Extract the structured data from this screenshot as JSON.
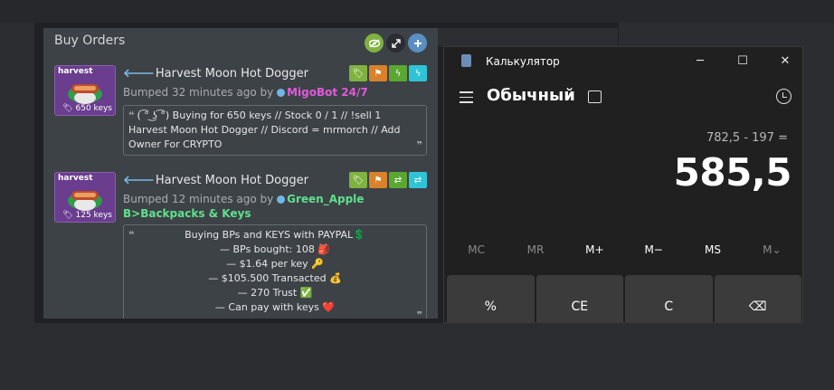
{
  "backpack": {
    "title": "Buy Orders",
    "header_buttons": [
      {
        "icon": "eye-icon",
        "color": "#7fb241"
      },
      {
        "icon": "expand-icon",
        "color": "#2b2d31"
      },
      {
        "icon": "plus-icon",
        "color": "#5a8fc4"
      }
    ],
    "listings": [
      {
        "thumb_name": "harvest",
        "thumb_price": "650 keys",
        "title": "Harvest Moon Hot Dogger",
        "bumped_prefix": "Bumped 32 minutes ago by",
        "user": "MigoBot 24/7",
        "user_color": "pink",
        "message": "( ͡° ͜ʖ ͡°) Buying for 650 keys // Stock 0 / 1 // !sell 1 Harvest Moon Hot Dogger // Discord = mrmorch // Add Owner For CRYPTO",
        "buttons": [
          "tag-icon",
          "flag-icon",
          "bolt-icon",
          "bolt-icon"
        ]
      },
      {
        "thumb_name": "harvest",
        "thumb_price": "125 keys",
        "title": "Harvest Moon Hot Dogger",
        "bumped_prefix": "Bumped 12 minutes ago by",
        "user": "Green_Apple B>Backpacks & Keys",
        "user_color": "green",
        "message_lines": [
          "Buying BPs and KEYS with PAYPAL💲",
          "— BPs bought: 108 🎒",
          "— $1.64 per key 🔑",
          "— $105.500 Transacted 💰",
          "— 270 Trust ✅",
          "— Can pay with keys ❤️"
        ],
        "buttons": [
          "tag-icon",
          "flag-icon",
          "swap-icon",
          "swap-icon"
        ]
      }
    ]
  },
  "calculator": {
    "window_title": "Калькулятор",
    "mode": "Обычный",
    "expression": "782,5 - 197 =",
    "result": "585,5",
    "memory_buttons": [
      "MC",
      "MR",
      "M+",
      "M−",
      "MS",
      "M⌄"
    ],
    "keys": [
      "%",
      "CE",
      "C",
      "⌫"
    ]
  },
  "colors": {
    "tag": "#7fb241",
    "flag": "#d9822b",
    "bolt_green": "#5aa832",
    "bolt_cyan": "#2ec4d6"
  }
}
